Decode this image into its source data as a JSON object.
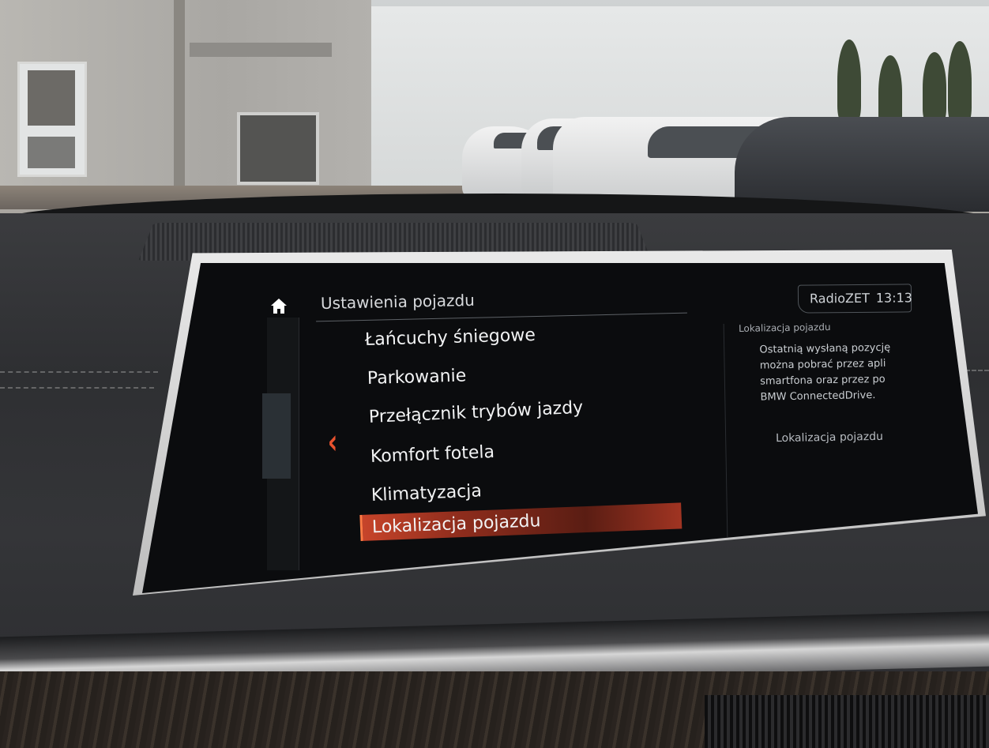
{
  "header": {
    "title": "Ustawienia pojazdu",
    "station": "RadioZET",
    "clock": "13:13"
  },
  "nav": {
    "home_icon": "home-icon",
    "back_icon": "chevron-left-icon"
  },
  "menu": {
    "items": [
      {
        "label": "Łańcuchy śniegowe"
      },
      {
        "label": "Parkowanie"
      },
      {
        "label": "Przełącznik trybów jazdy"
      },
      {
        "label": "Komfort fotela"
      },
      {
        "label": "Klimatyzacja"
      },
      {
        "label": "Lokalizacja pojazdu"
      }
    ],
    "selected_index": 5
  },
  "info_panel": {
    "title": "Lokalizacja pojazdu",
    "lines": [
      "Ostatnią wysłaną pozycję",
      "można pobrać przez apli",
      "smartfona oraz przez po",
      "BMW ConnectedDrive."
    ],
    "link": "Lokalizacja pojazdu"
  },
  "colors": {
    "accent": "#e8522e",
    "screen_bg": "#0b0c0e",
    "text": "#f2f3f4"
  }
}
